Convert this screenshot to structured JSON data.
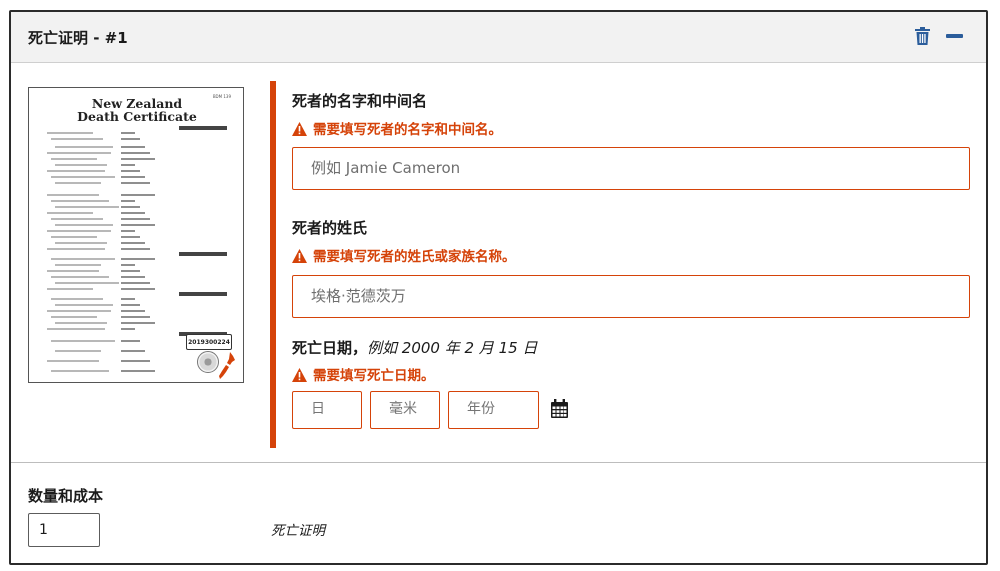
{
  "panel": {
    "title": "死亡证明 - #1",
    "delete_icon": "trash-icon",
    "collapse_icon": "minus-icon"
  },
  "certificate_thumbnail": {
    "title_line1": "New Zealand",
    "title_line2": "Death Certificate",
    "registration_number": "2019300224"
  },
  "fields": {
    "first_names": {
      "label": "死者的名字和中间名",
      "error": "需要填写死者的名字和中间名。",
      "placeholder": "例如 Jamie Cameron",
      "value": ""
    },
    "surname": {
      "label": "死者的姓氏",
      "error": "需要填写死者的姓氏或家族名称。",
      "placeholder": "埃格·范德茨万",
      "value": ""
    },
    "date_of_death": {
      "label": "死亡日期，",
      "hint": "例如 2000 年 2 月 15 日",
      "error": "需要填写死亡日期。",
      "day_placeholder": "日",
      "month_placeholder": "毫米",
      "year_placeholder": "年份",
      "calendar_icon": "calendar-icon"
    }
  },
  "quantity": {
    "title": "数量和成本",
    "value": "1",
    "item_label": "死亡证明"
  },
  "colors": {
    "error": "#d54309",
    "accent": "#2b5d9b",
    "header_bg": "#f2f2f2"
  }
}
